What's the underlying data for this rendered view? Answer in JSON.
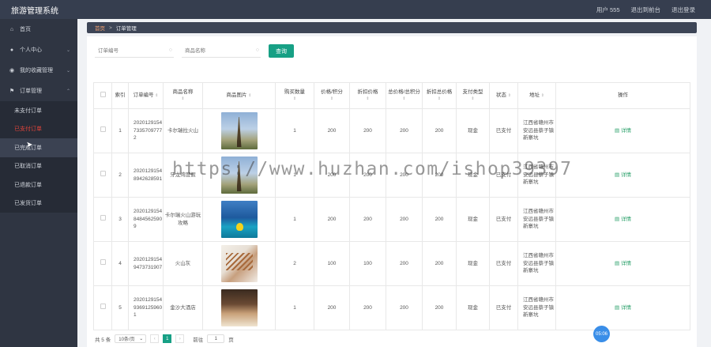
{
  "app": {
    "title": "旅游管理系统"
  },
  "topbar": {
    "user": "用户 555",
    "exit_backend": "退出到前台",
    "logout": "退出登录"
  },
  "sidebar": {
    "home": "首页",
    "personal": "个人中心",
    "favorites": "我的收藏管理",
    "orders": "订单管理",
    "sub": [
      "未支付订单",
      "已支付订单",
      "已完成订单",
      "已取消订单",
      "已退款订单",
      "已发货订单"
    ]
  },
  "breadcrumb": {
    "home": "首页",
    "sep": ">",
    "current": "订单管理"
  },
  "search": {
    "order_placeholder": "订单编号",
    "name_placeholder": "商品名称",
    "query_label": "查询"
  },
  "table": {
    "headers": [
      "索引",
      "订单编号",
      "商品名称",
      "商品图片",
      "购买数量",
      "价格/积分",
      "折扣价格",
      "总价格/总积分",
      "折扣总价格",
      "支付类型",
      "状态",
      "地址",
      "操作"
    ],
    "rows": [
      {
        "index": "1",
        "order_no": "20201291547335709777 2",
        "name": "卡尔瑞拉火山",
        "qty": "1",
        "price": "200",
        "discount": "200",
        "total": "200",
        "discount_total": "200",
        "pay": "现金",
        "status": "已支付",
        "address": "江西省赣州市安远县蔡子镇新寨坑",
        "action": "详情"
      },
      {
        "index": "2",
        "order_no": "20201291548942628591",
        "name": "牙龙湾度假",
        "qty": "1",
        "price": "200",
        "discount": "200",
        "total": "200",
        "discount_total": "200",
        "pay": "现金",
        "status": "已支付",
        "address": "江西省赣州市安远县蔡子镇新寨坑",
        "action": "详情"
      },
      {
        "index": "3",
        "order_no": "20201291548484562590 9",
        "name": "卡尔瑞火山游玩攻略",
        "qty": "1",
        "price": "200",
        "discount": "200",
        "total": "200",
        "discount_total": "200",
        "pay": "现金",
        "status": "已支付",
        "address": "江西省赣州市安远县蔡子镇新寨坑",
        "action": "详情"
      },
      {
        "index": "4",
        "order_no": "20201291549473731907",
        "name": "火山灰",
        "qty": "2",
        "price": "100",
        "discount": "100",
        "total": "200",
        "discount_total": "200",
        "pay": "现金",
        "status": "已支付",
        "address": "江西省赣州市安远县蔡子镇新寨坑",
        "action": "详情"
      },
      {
        "index": "5",
        "order_no": "20201291549369125960 1",
        "name": "金沙大酒店",
        "qty": "1",
        "price": "200",
        "discount": "200",
        "total": "200",
        "discount_total": "200",
        "pay": "现金",
        "status": "已支付",
        "address": "江西省赣州市安远县蔡子镇新寨坑",
        "action": "详情"
      }
    ]
  },
  "pager": {
    "total": "共 5 条",
    "page_size": "10条/页",
    "current": "1",
    "goto": "前往",
    "goto_value": "1",
    "page_unit": "页"
  },
  "watermark": "https://www.huzhan.com/ishop39397",
  "float_badge": "05:06",
  "colors": {
    "accent": "#17a085",
    "sidebar_bg": "#2f3542",
    "active_text": "#e4443a"
  }
}
